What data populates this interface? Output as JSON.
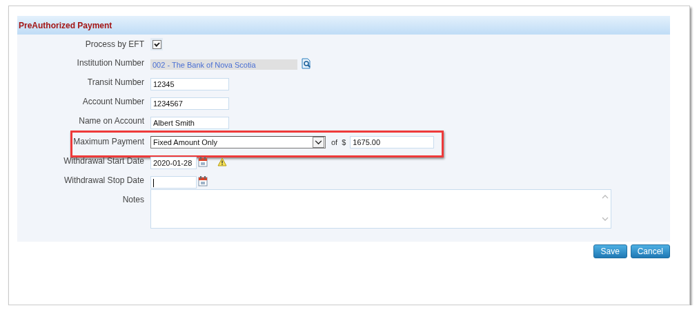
{
  "panel": {
    "title": "PreAuthorized Payment"
  },
  "fields": [
    {
      "kind": "checkbox",
      "label": "Process by EFT",
      "checked": true
    },
    {
      "kind": "lookup",
      "label": "Institution Number",
      "value": "002 - The Bank of Nova Scotia"
    },
    {
      "kind": "text",
      "label": "Transit Number",
      "value": "12345"
    },
    {
      "kind": "text",
      "label": "Account Number",
      "value": "1234567"
    },
    {
      "kind": "text",
      "label": "Name on Account",
      "value": "Albert Smith"
    },
    {
      "kind": "amount",
      "label": "Maximum Payment",
      "value": "Fixed Amount Only",
      "of": "of",
      "currency": "$",
      "amount": "1675.00",
      "highlighted": true
    },
    {
      "kind": "date",
      "label": "Withdrawal Start Date",
      "value": "2020-01-28",
      "warning": true
    },
    {
      "kind": "date",
      "label": "Withdrawal Stop Date"
    },
    {
      "kind": "notes",
      "label": "Notes"
    }
  ],
  "buttons": [
    {
      "label": "Save"
    },
    {
      "label": "Cancel"
    }
  ]
}
